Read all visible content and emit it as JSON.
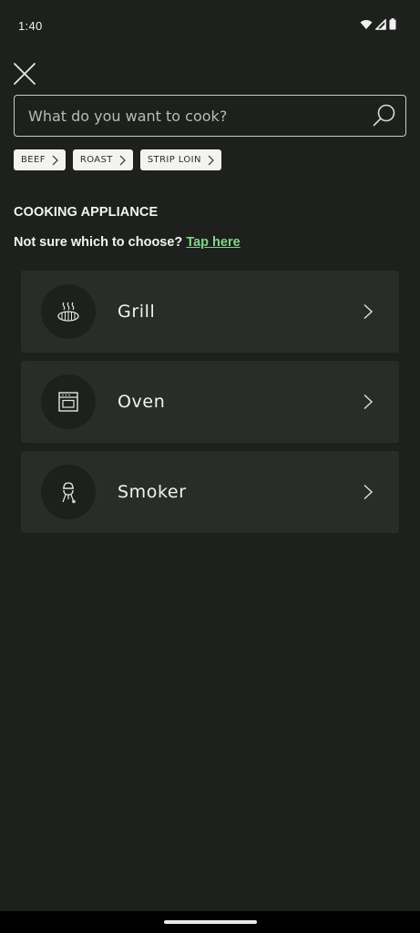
{
  "status_bar": {
    "time": "1:40"
  },
  "search": {
    "placeholder": "What do you want to cook?",
    "value": ""
  },
  "chips": [
    {
      "label": "BEEF"
    },
    {
      "label": "ROAST"
    },
    {
      "label": "STRIP LOIN"
    }
  ],
  "section": {
    "title": "COOKING APPLIANCE",
    "helper_text": "Not sure which to choose?",
    "helper_link": "Tap here"
  },
  "appliances": [
    {
      "label": "Grill",
      "icon": "grill-icon"
    },
    {
      "label": "Oven",
      "icon": "oven-icon"
    },
    {
      "label": "Smoker",
      "icon": "smoker-icon"
    }
  ],
  "colors": {
    "background": "#1e201e",
    "card": "#2a2c2a",
    "link": "#7ed58a",
    "chip": "#f3f4f1"
  }
}
